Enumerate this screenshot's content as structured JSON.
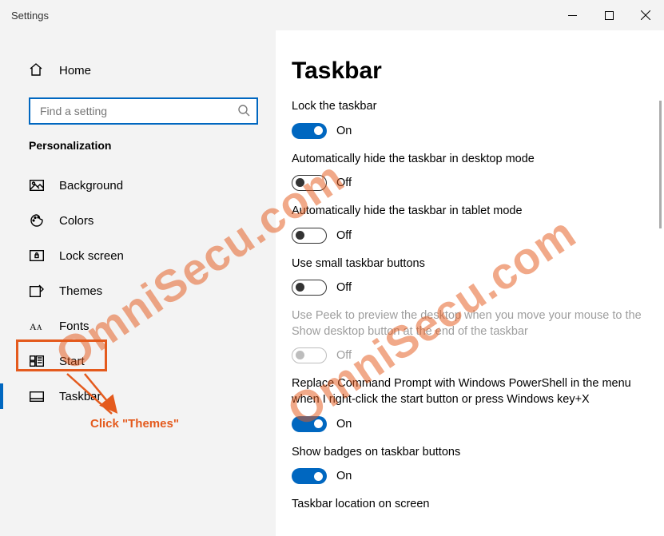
{
  "window": {
    "title": "Settings"
  },
  "home": {
    "label": "Home"
  },
  "search": {
    "placeholder": "Find a setting"
  },
  "section": {
    "title": "Personalization"
  },
  "nav": {
    "items": [
      {
        "label": "Background"
      },
      {
        "label": "Colors"
      },
      {
        "label": "Lock screen"
      },
      {
        "label": "Themes"
      },
      {
        "label": "Fonts"
      },
      {
        "label": "Start"
      },
      {
        "label": "Taskbar"
      }
    ],
    "selected_index": 6,
    "highlighted_index": 3
  },
  "annotation": {
    "text": "Click \"Themes\""
  },
  "page": {
    "title": "Taskbar"
  },
  "settings": [
    {
      "label": "Lock the taskbar",
      "value": true,
      "state": "On",
      "enabled": true
    },
    {
      "label": "Automatically hide the taskbar in desktop mode",
      "value": false,
      "state": "Off",
      "enabled": true
    },
    {
      "label": "Automatically hide the taskbar in tablet mode",
      "value": false,
      "state": "Off",
      "enabled": true
    },
    {
      "label": "Use small taskbar buttons",
      "value": false,
      "state": "Off",
      "enabled": true
    },
    {
      "label": "Use Peek to preview the desktop when you move your mouse to the Show desktop button at the end of the taskbar",
      "value": false,
      "state": "Off",
      "enabled": false
    },
    {
      "label": "Replace Command Prompt with Windows PowerShell in the menu when I right-click the start button or press Windows key+X",
      "value": true,
      "state": "On",
      "enabled": true
    },
    {
      "label": "Show badges on taskbar buttons",
      "value": true,
      "state": "On",
      "enabled": true
    }
  ],
  "extra_label": "Taskbar location on screen",
  "watermark": "OmniSecu.com"
}
